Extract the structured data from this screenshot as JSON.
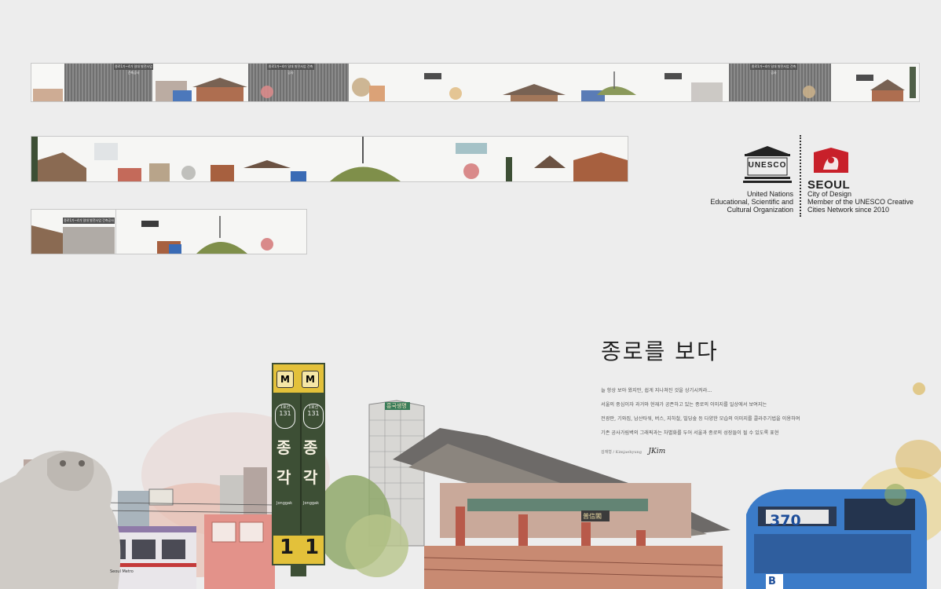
{
  "strips": {
    "header_text": "종로1가~4가 일대 발전사업 건축공사",
    "caption_text": "종로를 보다"
  },
  "unesco": {
    "logo_word": "UNESCO",
    "line1": "United Nations",
    "line2": "Educational, Scientific and",
    "line3": "Cultural Organization"
  },
  "seoul": {
    "logo_word": "SEOUL",
    "line1": "City of Design",
    "line2": "Member of the UNESCO Creative",
    "line3": "Cities Network since 2010"
  },
  "article": {
    "title": "종로를 보다",
    "lines": [
      "늘 항상 보아 왔지만, 쉽게 지나쳐진 것을 상기시켜라...",
      "서울의 중심이자 과거와 현재가 공존하고 있는 종로의 이미지를 일상에서 보여지는",
      "전광판, 기와집, 남산타워, 버스, 지하철, 빌딩숲 등 다양한 모습의 이미지를 콜라주기법을 이용하여",
      "기존 공사가림벽의 그래픽과는 차별화를 두어 서울과 종로의 성장들이 될 수 있도록 표현"
    ],
    "credit": "김재형 / Kimjaehyung",
    "signature": "JKim"
  },
  "station_sign": {
    "line_circle": "1호선",
    "station_number": "131",
    "char1": "종",
    "char2": "각",
    "roman": "Jonggak",
    "line_number": "1"
  },
  "bus": {
    "number": "370",
    "letter": "B"
  },
  "building": {
    "sign_text": "흥국생명"
  },
  "gate": {
    "plaque": "普信閣"
  },
  "train": {
    "text": "Seoul Metro"
  },
  "colors": {
    "background": "#ededed",
    "sign_green": "#3d4f35",
    "sign_yellow": "#e3c13a",
    "bus_blue": "#3b7bc8",
    "seoul_red": "#c8202a"
  }
}
